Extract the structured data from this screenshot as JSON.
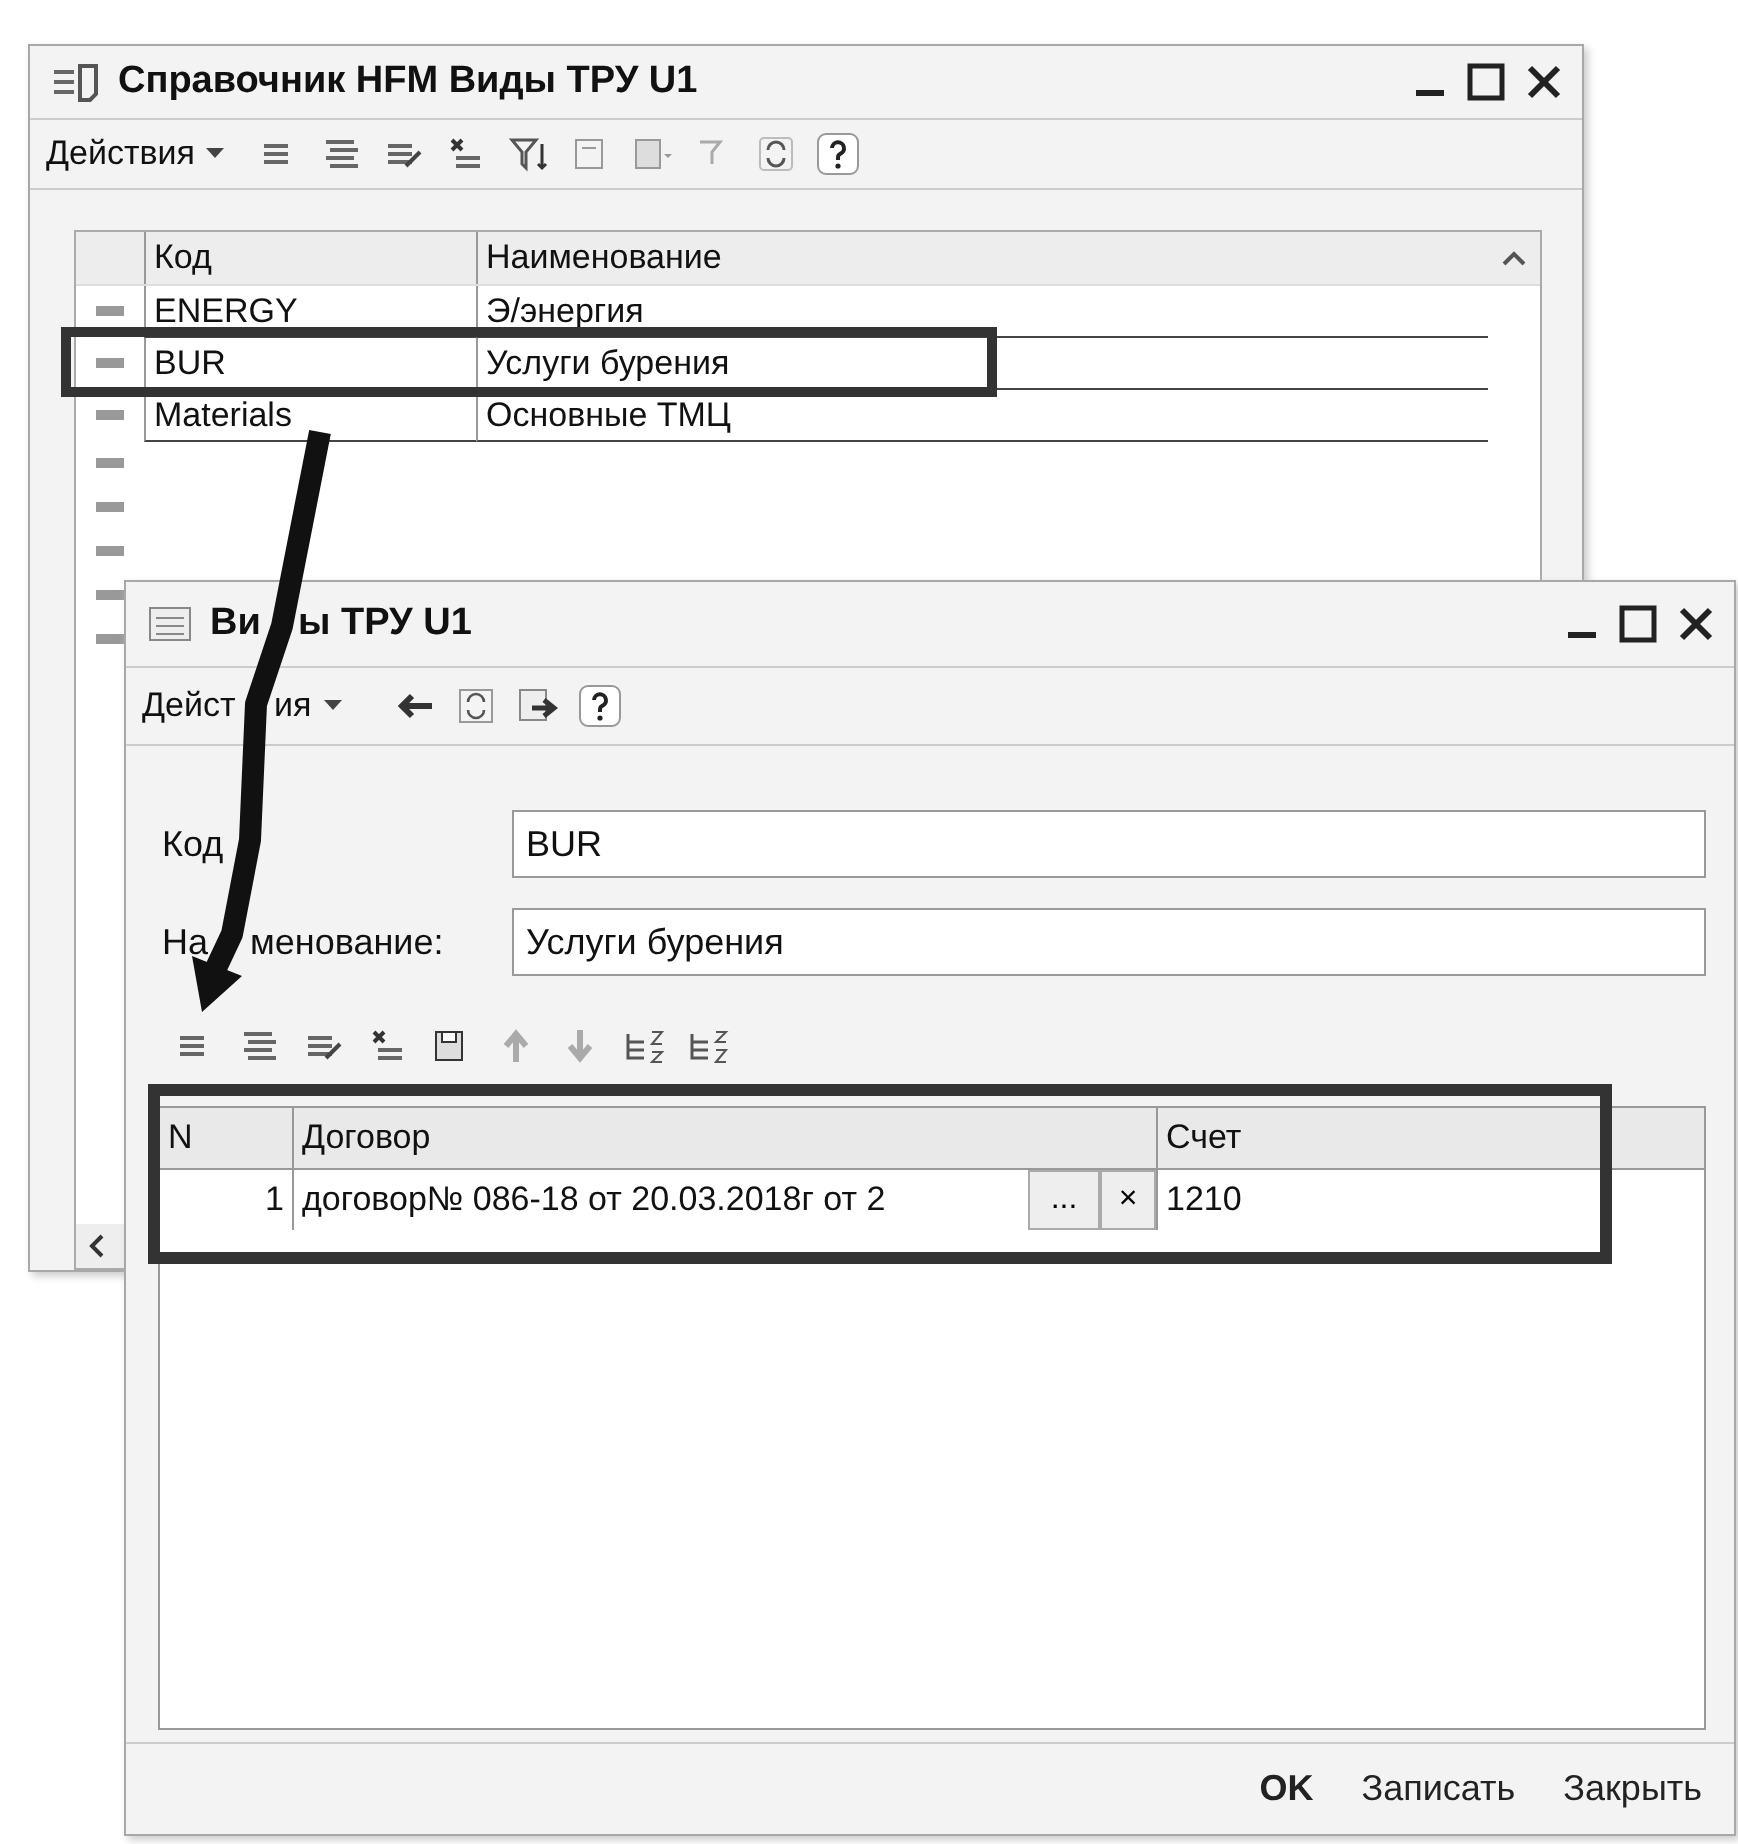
{
  "back_window": {
    "title": "Справочник HFM Виды ТРУ U1",
    "actions_menu": "Действия",
    "table": {
      "columns": [
        "Код",
        "Наименование"
      ],
      "rows": [
        {
          "code": "ENERGY",
          "name": "Э/энергия"
        },
        {
          "code": "BUR",
          "name": "Услуги бурения"
        },
        {
          "code": "Materials",
          "name": "Основные ТМЦ"
        }
      ]
    }
  },
  "front_window": {
    "title": [
      "Ви",
      "ы ТРУ U1"
    ],
    "actions_menu": [
      "Дейст",
      "ия"
    ],
    "fields": [
      {
        "label": [
          "Код"
        ],
        "value": "BUR"
      },
      {
        "label": [
          "На",
          "менование:"
        ],
        "value": "Услуги бурения"
      }
    ],
    "table": {
      "columns": [
        "N",
        "Договор",
        "Счет"
      ],
      "rows": [
        {
          "n": "1",
          "contract": "договор№ 086-18 от 20.03.2018г от 2",
          "choose": "...",
          "clear": "×",
          "account": "1210"
        }
      ]
    },
    "buttons": [
      {
        "label": "OK",
        "default": true
      },
      {
        "label": "Записать",
        "default": false
      },
      {
        "label": "Закрыть",
        "default": false
      }
    ]
  }
}
